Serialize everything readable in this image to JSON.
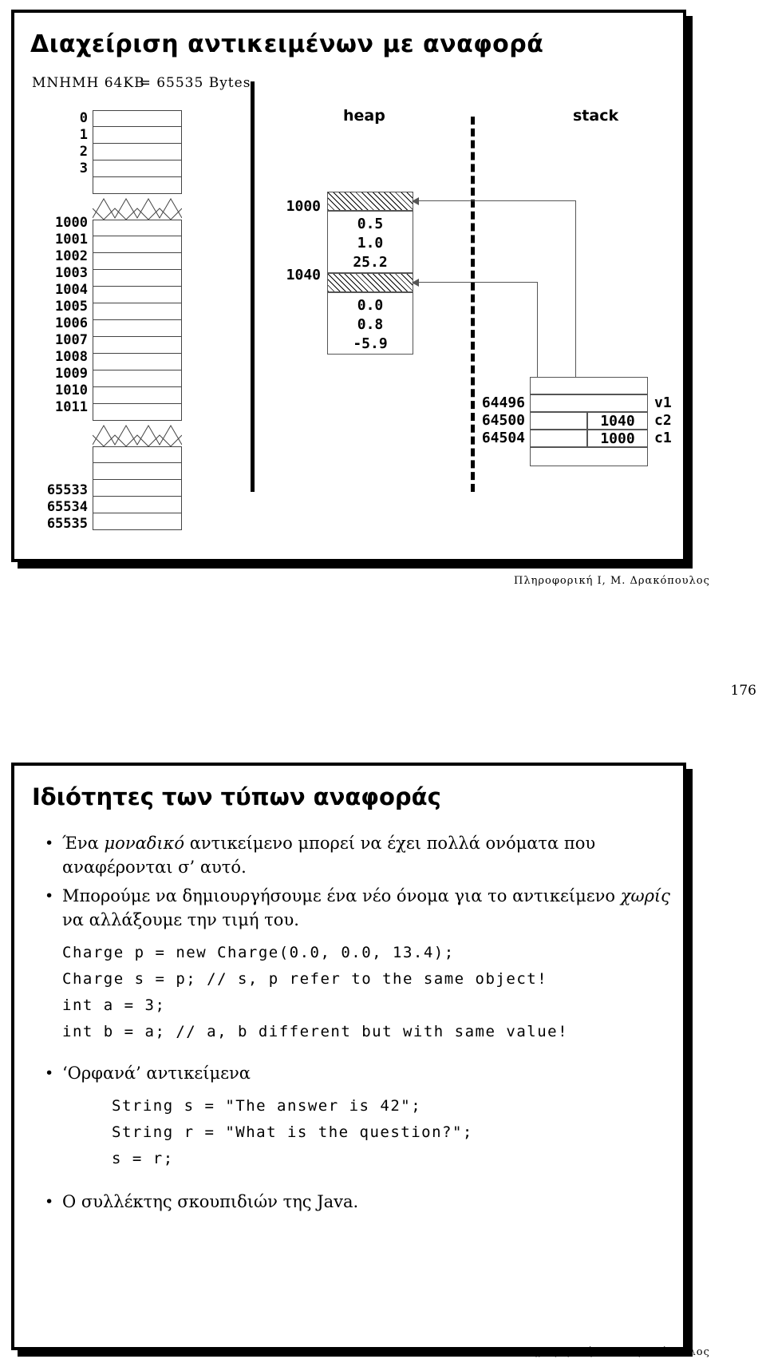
{
  "slide1": {
    "title": "Διαχείριση αντικειμένων με αναφορά",
    "subtitle_a": "ΜΝΗΜΗ 64KB",
    "subtitle_b": "= 65535 Bytes",
    "memory_labels_top": [
      "0",
      "1",
      "2",
      "3"
    ],
    "memory_labels_mid": [
      "1000",
      "1001",
      "1002",
      "1003",
      "1004",
      "1005",
      "1006",
      "1007",
      "1008",
      "1009",
      "1010",
      "1011"
    ],
    "memory_labels_bottom": [
      "65533",
      "65534",
      "65535"
    ],
    "heap_header": "heap",
    "stack_header": "stack",
    "heap_blocks": [
      {
        "address": "1000",
        "values": [
          "0.5",
          "1.0",
          "25.2"
        ]
      },
      {
        "address": "1040",
        "values": [
          "0.0",
          "0.8",
          "-5.9"
        ]
      }
    ],
    "stack_rows": [
      {
        "address": "64496",
        "value": "",
        "name": "v1"
      },
      {
        "address": "64500",
        "value": "1040",
        "name": "c2"
      },
      {
        "address": "64504",
        "value": "1000",
        "name": "c1"
      }
    ],
    "footer": "Πληροφορική Ι, Μ. Δρακόπουλος"
  },
  "page_number": "176",
  "slide2": {
    "title": "Ιδιότητες των τύπων αναφοράς",
    "bullet1_a": "Ένα ",
    "bullet1_em": "μοναδικό",
    "bullet1_b": " αντικείμενο μπορεί να έχει πολλά ονόματα που αναφέρονται σ’ αυτό.",
    "bullet2_a": "Μπορούμε να δημιουργήσουμε ένα νέο όνομα για το αντικείμενο ",
    "bullet2_em": "χωρίς",
    "bullet2_b": " να αλλάξουμε την τιμή του.",
    "code_block_1": [
      "Charge p = new Charge(0.0, 0.0, 13.4);",
      "Charge s = p; // s, p refer to the same object!",
      "int a = 3;",
      "int b = a; // a, b different but with same value!"
    ],
    "bullet3": "‘Ορφανά’ αντικείμενα",
    "code_block_2": [
      "String s = \"The answer is 42\";",
      "String r = \"What is the question?\";",
      "s = r;"
    ],
    "bullet4": "Ο συλλέκτης σκουπιδιών της Java.",
    "footer": "Πληροφορική Ι, Μ. Δρακόπουλος"
  }
}
